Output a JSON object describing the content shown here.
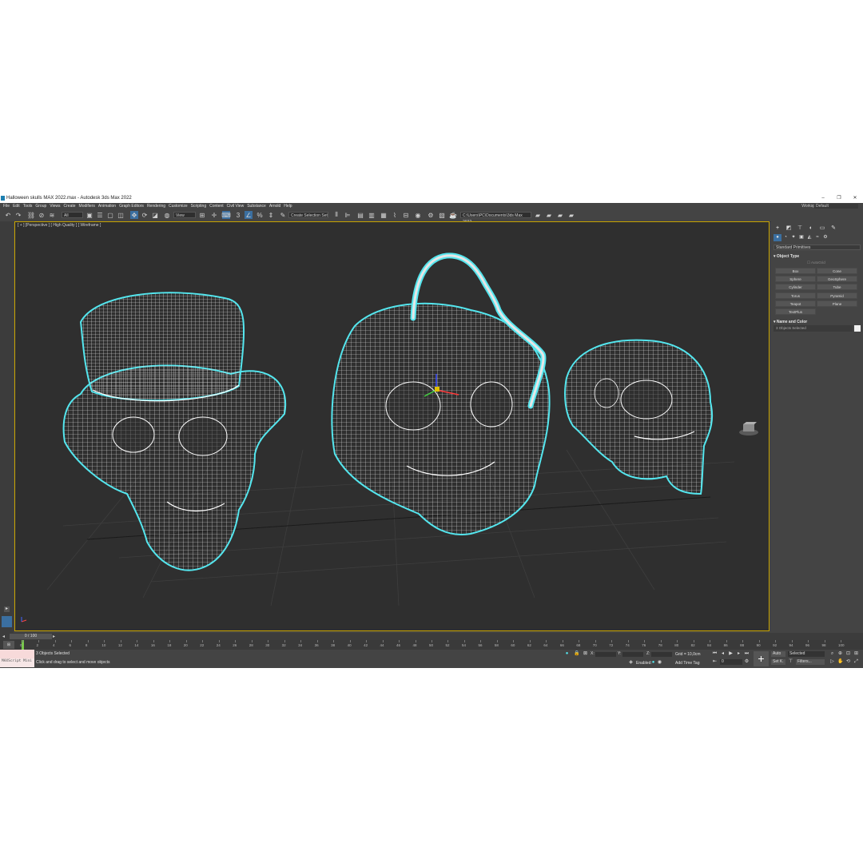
{
  "window": {
    "title": "Halloween skulls MAX 2022.max - Autodesk 3ds Max 2022",
    "min": "–",
    "max": "❐",
    "close": "✕"
  },
  "menu": {
    "items": [
      "File",
      "Edit",
      "Tools",
      "Group",
      "Views",
      "Create",
      "Modifiers",
      "Animation",
      "Graph Editors",
      "Rendering",
      "Customize",
      "Scripting",
      "Content",
      "Civil View",
      "Substance",
      "Arnold",
      "Help"
    ],
    "workspaces_label": "Workspaces:",
    "workspaces_value": "Default"
  },
  "toolbar": {
    "selection_filter": "All",
    "ref_coord": "View",
    "selection_set": "Create Selection Set",
    "project_path": "C:\\Users\\PC\\Documents\\3ds Max 2022"
  },
  "viewport": {
    "label": "[ + ] [Perspective ] [ High Quality ] [ Wireframe ]",
    "colors": {
      "wire": "#ffffff",
      "selection": "#54e6ee",
      "grid": "#3c3c3c",
      "background": "#2f2f2f"
    }
  },
  "command_panel": {
    "category": "Standard Primitives",
    "object_type_title": "Object Type",
    "autogrid_label": "AutoGrid",
    "primitives": [
      "Box",
      "Cone",
      "Sphere",
      "GeoSphere",
      "Cylinder",
      "Tube",
      "Torus",
      "Pyramid",
      "Teapot",
      "Plane",
      "TextPlus"
    ],
    "name_color_title": "Name and Color",
    "name_value": "3 Objects Selected"
  },
  "timeline": {
    "slider_label": "0 / 100",
    "current_frame": 0,
    "total_frames": 100,
    "ticks": [
      "0",
      "2",
      "4",
      "6",
      "8",
      "10",
      "12",
      "14",
      "16",
      "18",
      "20",
      "22",
      "24",
      "26",
      "28",
      "30",
      "32",
      "34",
      "36",
      "38",
      "40",
      "42",
      "44",
      "46",
      "48",
      "50",
      "52",
      "54",
      "56",
      "58",
      "60",
      "62",
      "64",
      "66",
      "68",
      "70",
      "72",
      "74",
      "76",
      "78",
      "80",
      "82",
      "84",
      "86",
      "88",
      "90",
      "92",
      "94",
      "96",
      "98",
      "100"
    ]
  },
  "status": {
    "maxscript_label": "MAXScript Mini",
    "selected": "3 Objects Selected",
    "prompt": "Click and drag to select and move objects",
    "x_label": "X:",
    "y_label": "Y:",
    "z_label": "Z:",
    "grid": "Grid = 10,0cm",
    "enabled_label": "Enabled:",
    "add_time_tag": "Add Time Tag",
    "auto_label": "Auto",
    "selected_dropdown": "Selected",
    "set_key_label": "Set K.",
    "filters_label": "Filters...",
    "frame_value": "0"
  }
}
